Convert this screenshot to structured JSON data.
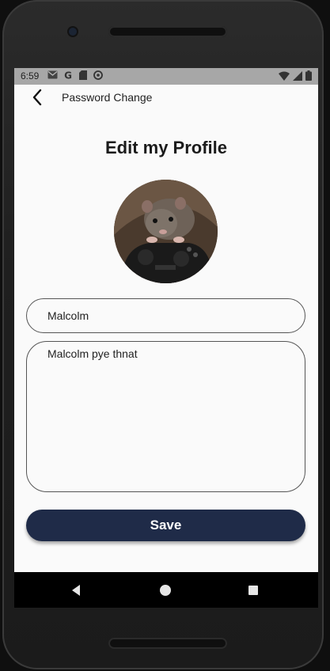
{
  "status_bar": {
    "time": "6:59",
    "left_icons": [
      "gmail-icon",
      "google-icon",
      "sd-card-icon",
      "sync-icon"
    ],
    "right_icons": [
      "wifi-icon",
      "signal-icon",
      "battery-icon"
    ]
  },
  "header": {
    "back_icon": "chevron-left-icon",
    "title": "Password Change"
  },
  "page": {
    "title": "Edit my Profile"
  },
  "profile": {
    "name_value": "Malcolm",
    "bio_value": "Malcolm pye thnat"
  },
  "actions": {
    "save_label": "Save"
  },
  "colors": {
    "primary": "#1f2b48",
    "status_bar": "#a7a7a7",
    "screen_bg": "#fafafa",
    "nav_bar": "#000000"
  },
  "nav_bar": {
    "icons": [
      "nav-back-icon",
      "nav-home-icon",
      "nav-recent-apps-icon"
    ]
  }
}
